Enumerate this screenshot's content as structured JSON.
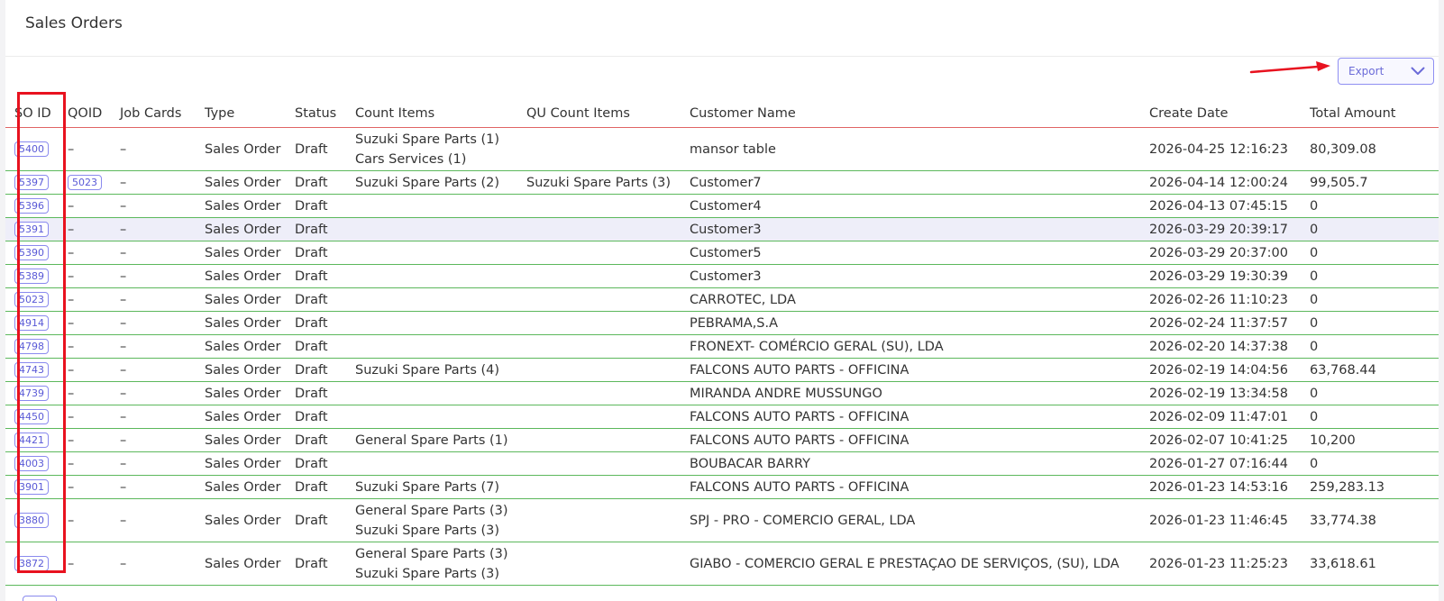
{
  "page": {
    "title": "Sales Orders",
    "export_label": "Export",
    "colors": {
      "accent": "#6b6bd8",
      "highlight_box": "#e8121f",
      "row_divider": "#5cb85c",
      "header_divider": "#e06464"
    }
  },
  "table": {
    "headers": {
      "so_id": "SO ID",
      "qoid": "QOID",
      "job_cards": "Job Cards",
      "type": "Type",
      "status": "Status",
      "count_items": "Count Items",
      "qu_count_items": "QU Count Items",
      "customer_name": "Customer Name",
      "create_date": "Create Date",
      "total_amount": "Total Amount"
    },
    "rows": [
      {
        "so_id": "5400",
        "qoid": "–",
        "job_cards": "–",
        "type": "Sales Order",
        "status": "Draft",
        "count_items": [
          "Suzuki Spare Parts (1)",
          "Cars Services (1)"
        ],
        "qu_count_items": [],
        "customer": "mansor table",
        "date": "2026-04-25 12:16:23",
        "amount": "80,309.08"
      },
      {
        "so_id": "5397",
        "qoid": "5023",
        "job_cards": "–",
        "type": "Sales Order",
        "status": "Draft",
        "count_items": [
          "Suzuki Spare Parts (2)"
        ],
        "qu_count_items": [
          "Suzuki Spare Parts (3)"
        ],
        "customer": "Customer7",
        "date": "2026-04-14 12:00:24",
        "amount": "99,505.7"
      },
      {
        "so_id": "5396",
        "qoid": "–",
        "job_cards": "–",
        "type": "Sales Order",
        "status": "Draft",
        "count_items": [],
        "qu_count_items": [],
        "customer": "Customer4",
        "date": "2026-04-13 07:45:15",
        "amount": "0"
      },
      {
        "so_id": "5391",
        "qoid": "–",
        "job_cards": "–",
        "type": "Sales Order",
        "status": "Draft",
        "count_items": [],
        "qu_count_items": [],
        "customer": "Customer3",
        "date": "2026-03-29 20:39:17",
        "amount": "0",
        "highlighted": true
      },
      {
        "so_id": "5390",
        "qoid": "–",
        "job_cards": "–",
        "type": "Sales Order",
        "status": "Draft",
        "count_items": [],
        "qu_count_items": [],
        "customer": "Customer5",
        "date": "2026-03-29 20:37:00",
        "amount": "0"
      },
      {
        "so_id": "5389",
        "qoid": "–",
        "job_cards": "–",
        "type": "Sales Order",
        "status": "Draft",
        "count_items": [],
        "qu_count_items": [],
        "customer": "Customer3",
        "date": "2026-03-29 19:30:39",
        "amount": "0"
      },
      {
        "so_id": "5023",
        "qoid": "–",
        "job_cards": "–",
        "type": "Sales Order",
        "status": "Draft",
        "count_items": [],
        "qu_count_items": [],
        "customer": "CARROTEC, LDA",
        "date": "2026-02-26 11:10:23",
        "amount": "0"
      },
      {
        "so_id": "4914",
        "qoid": "–",
        "job_cards": "–",
        "type": "Sales Order",
        "status": "Draft",
        "count_items": [],
        "qu_count_items": [],
        "customer": "PEBRAMA,S.A",
        "date": "2026-02-24 11:37:57",
        "amount": "0"
      },
      {
        "so_id": "4798",
        "qoid": "–",
        "job_cards": "–",
        "type": "Sales Order",
        "status": "Draft",
        "count_items": [],
        "qu_count_items": [],
        "customer": "FRONEXT- COMÉRCIO GERAL (SU), LDA",
        "date": "2026-02-20 14:37:38",
        "amount": "0"
      },
      {
        "so_id": "4743",
        "qoid": "–",
        "job_cards": "–",
        "type": "Sales Order",
        "status": "Draft",
        "count_items": [
          "Suzuki Spare Parts (4)"
        ],
        "qu_count_items": [],
        "customer": "FALCONS AUTO PARTS - OFFICINA",
        "date": "2026-02-19 14:04:56",
        "amount": "63,768.44"
      },
      {
        "so_id": "4739",
        "qoid": "–",
        "job_cards": "–",
        "type": "Sales Order",
        "status": "Draft",
        "count_items": [],
        "qu_count_items": [],
        "customer": "MIRANDA ANDRE MUSSUNGO",
        "date": "2026-02-19 13:34:58",
        "amount": "0"
      },
      {
        "so_id": "4450",
        "qoid": "–",
        "job_cards": "–",
        "type": "Sales Order",
        "status": "Draft",
        "count_items": [],
        "qu_count_items": [],
        "customer": "FALCONS AUTO PARTS - OFFICINA",
        "date": "2026-02-09 11:47:01",
        "amount": "0"
      },
      {
        "so_id": "4421",
        "qoid": "–",
        "job_cards": "–",
        "type": "Sales Order",
        "status": "Draft",
        "count_items": [
          "General Spare Parts (1)"
        ],
        "qu_count_items": [],
        "customer": "FALCONS AUTO PARTS - OFFICINA",
        "date": "2026-02-07 10:41:25",
        "amount": "10,200"
      },
      {
        "so_id": "4003",
        "qoid": "–",
        "job_cards": "–",
        "type": "Sales Order",
        "status": "Draft",
        "count_items": [],
        "qu_count_items": [],
        "customer": "BOUBACAR BARRY",
        "date": "2026-01-27 07:16:44",
        "amount": "0"
      },
      {
        "so_id": "3901",
        "qoid": "–",
        "job_cards": "–",
        "type": "Sales Order",
        "status": "Draft",
        "count_items": [
          "Suzuki Spare Parts (7)"
        ],
        "qu_count_items": [],
        "customer": "FALCONS AUTO PARTS - OFFICINA",
        "date": "2026-01-23 14:53:16",
        "amount": "259,283.13"
      },
      {
        "so_id": "3880",
        "qoid": "–",
        "job_cards": "–",
        "type": "Sales Order",
        "status": "Draft",
        "count_items": [
          "General Spare Parts (3)",
          "Suzuki Spare Parts (3)"
        ],
        "qu_count_items": [],
        "customer": "SPJ - PRO - COMERCIO GERAL, LDA",
        "date": "2026-01-23 11:46:45",
        "amount": "33,774.38"
      },
      {
        "so_id": "3872",
        "qoid": "–",
        "job_cards": "–",
        "type": "Sales Order",
        "status": "Draft",
        "count_items": [
          "General Spare Parts (3)",
          "Suzuki Spare Parts (3)"
        ],
        "qu_count_items": [],
        "customer": "GIABO - COMERCIO GERAL E PRESTAÇAO DE SERVIÇOS, (SU), LDA",
        "date": "2026-01-23 11:25:23",
        "amount": "33,618.61"
      }
    ]
  }
}
